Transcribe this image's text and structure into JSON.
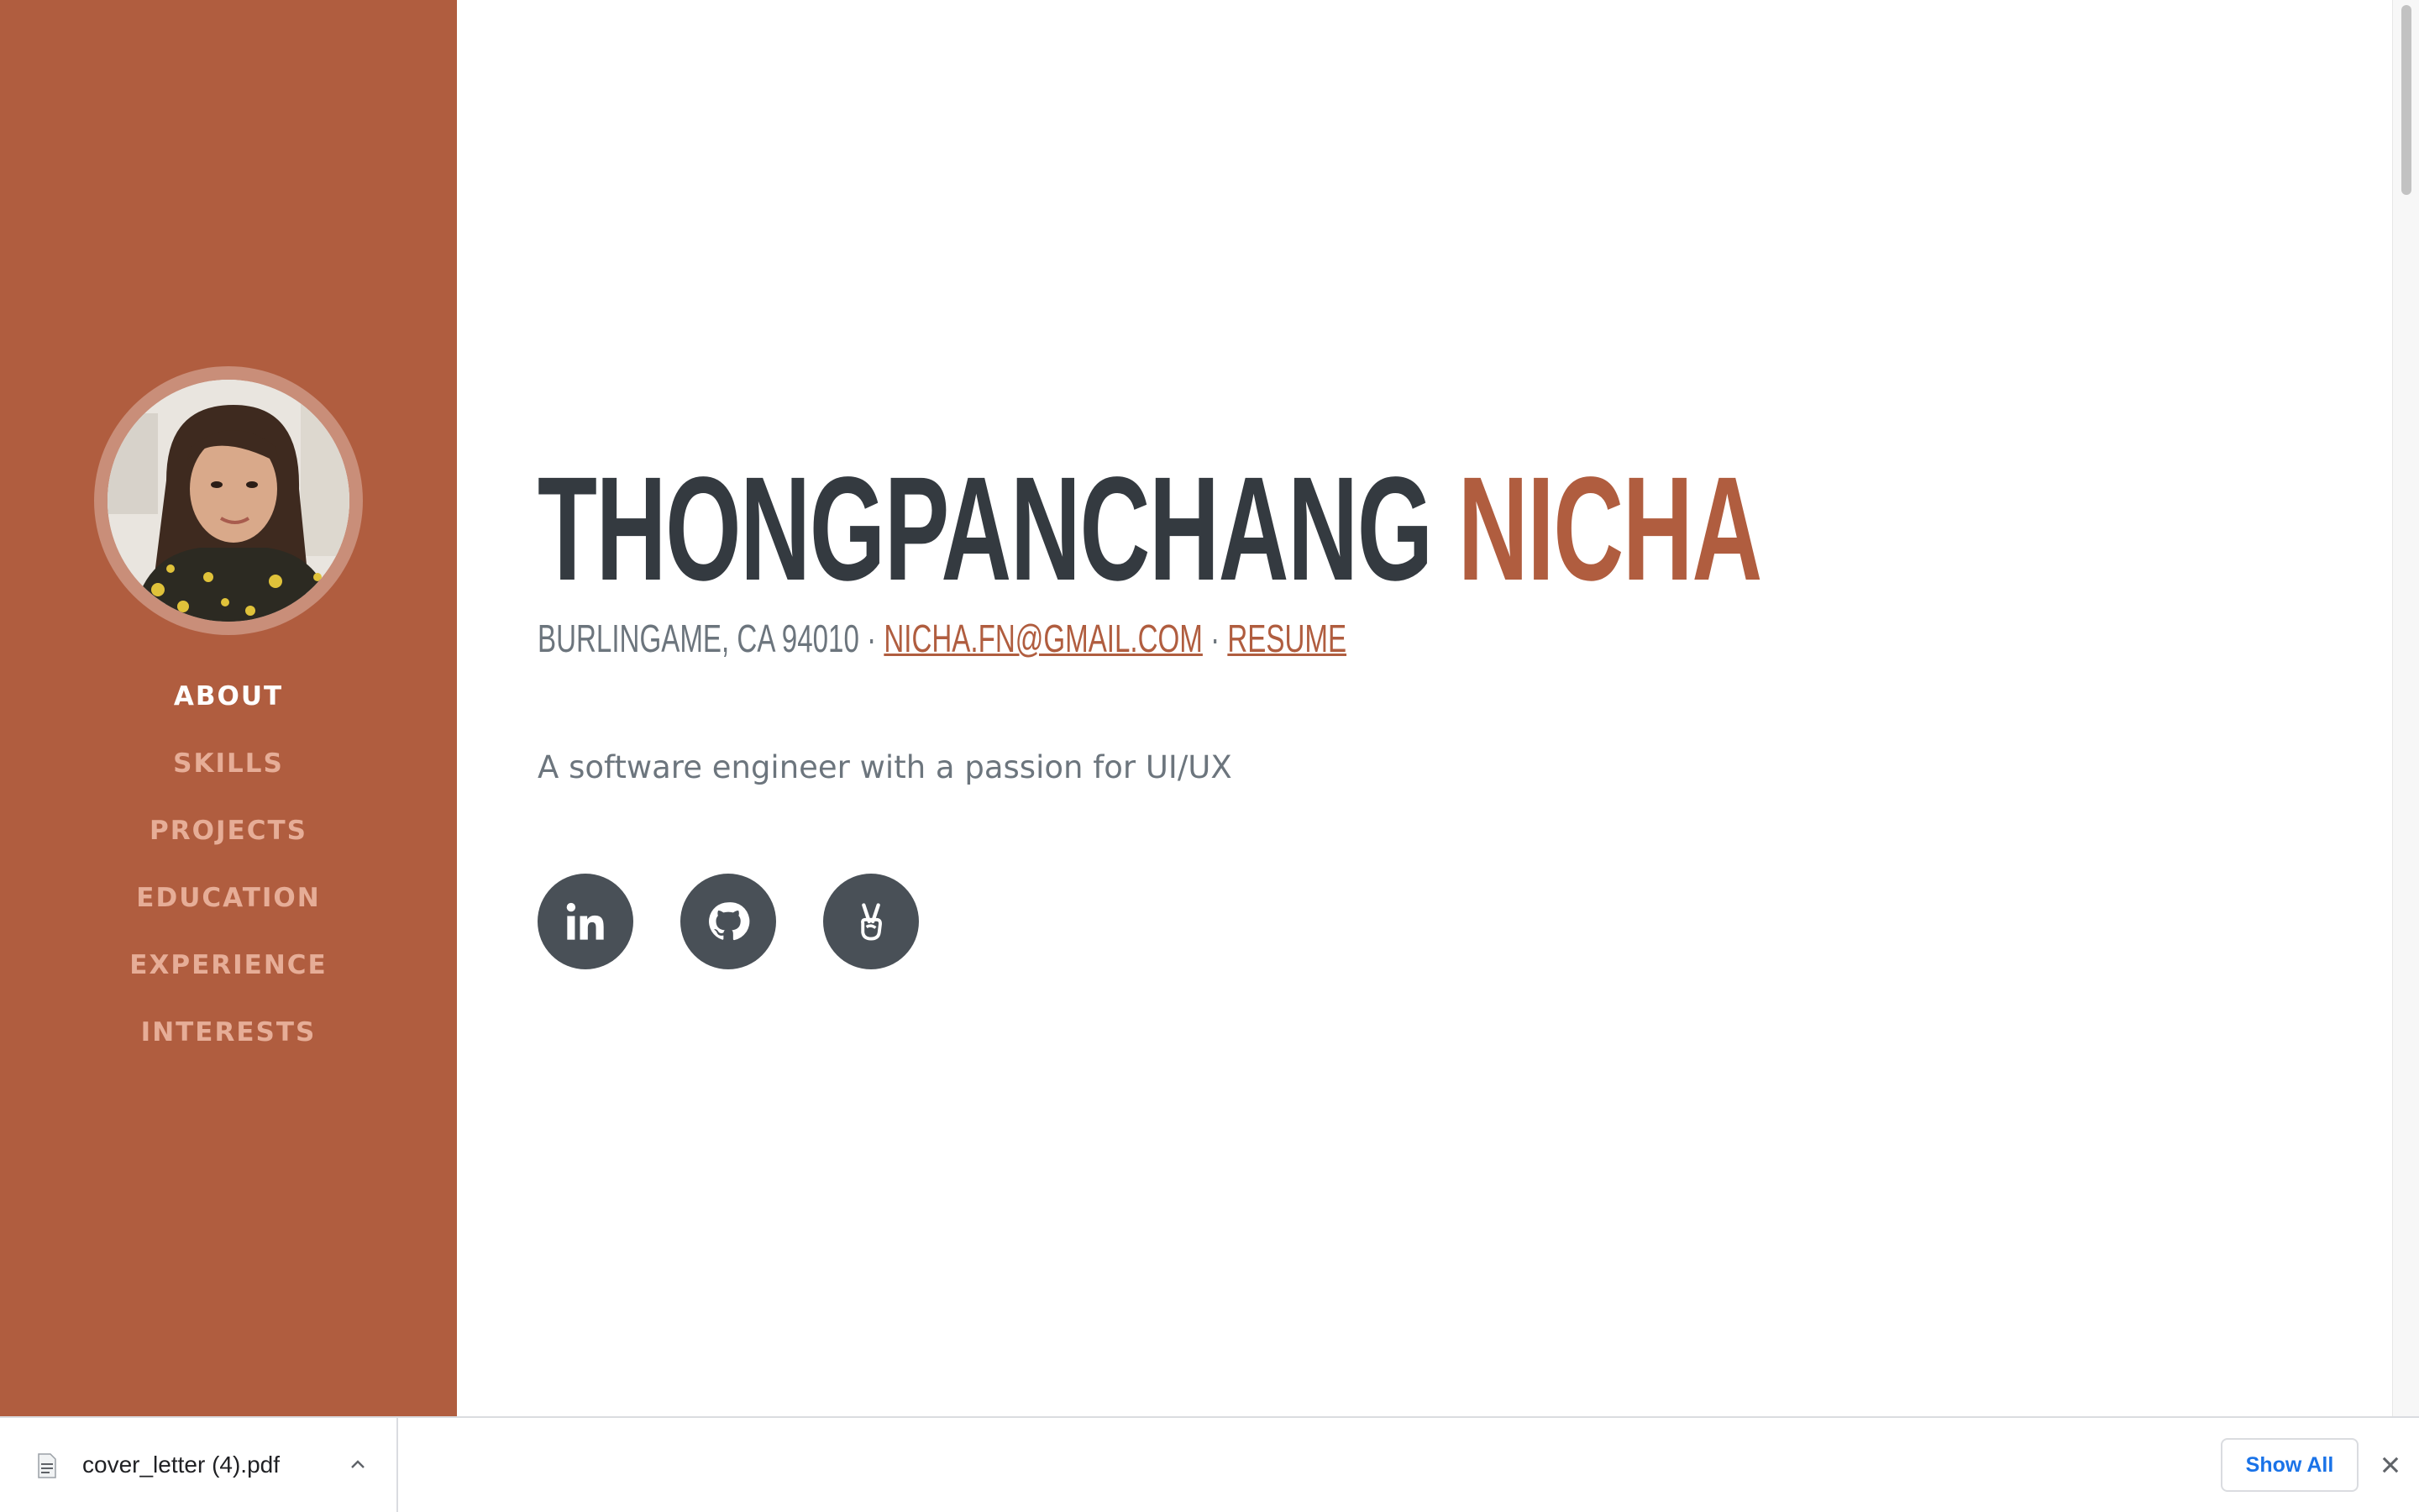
{
  "sidebar": {
    "avatar_alt": "Profile photo",
    "nav": [
      {
        "label": "About",
        "active": true
      },
      {
        "label": "Skills",
        "active": false
      },
      {
        "label": "Projects",
        "active": false
      },
      {
        "label": "Education",
        "active": false
      },
      {
        "label": "Experience",
        "active": false
      },
      {
        "label": "Interests",
        "active": false
      }
    ]
  },
  "main": {
    "name_first": "THONGPANCHANG",
    "name_last": "NICHA",
    "location": "BURLINGAME, CA 94010",
    "separator": "·",
    "email": "NICHA.FN@GMAIL.COM",
    "resume": "RESUME",
    "lead": "A software engineer with a passion for UI/UX",
    "social": [
      {
        "icon": "linkedin-icon"
      },
      {
        "icon": "github-icon"
      },
      {
        "icon": "angellist-icon"
      }
    ]
  },
  "download_bar": {
    "filename": "cover_letter (4).pdf",
    "show_all": "Show All"
  },
  "colors": {
    "sidebar": "#b05d3f",
    "accent": "#b05d3f",
    "heading": "#343a40",
    "muted": "#6c757d",
    "social_bg": "#495057",
    "nav_inactive": "#e6ad97",
    "link_blue": "#1a73e8"
  }
}
